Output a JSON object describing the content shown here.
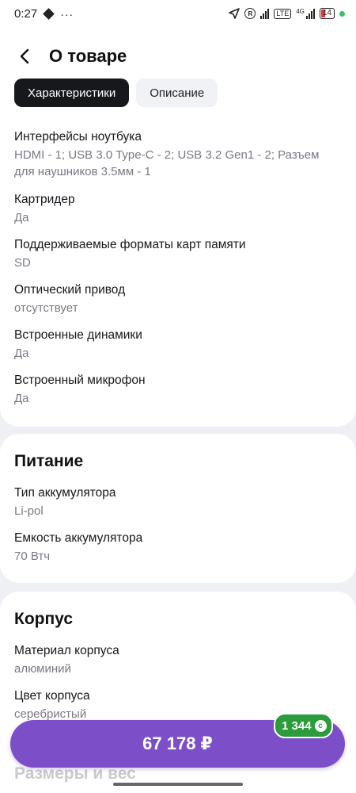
{
  "status_bar": {
    "time": "0:27",
    "battery": "14",
    "net_badge": "4G"
  },
  "header": {
    "title": "О товаре"
  },
  "tabs": [
    {
      "label": "Характеристики",
      "active": true
    },
    {
      "label": "Описание",
      "active": false
    }
  ],
  "specs_general": [
    {
      "label": "Интерфейсы ноутбука",
      "value": "HDMI - 1; USB 3.0 Type-C - 2; USB 3.2 Gen1 - 2; Разъем для наушников 3.5мм - 1"
    },
    {
      "label": "Картридер",
      "value": "Да"
    },
    {
      "label": "Поддерживаемые форматы карт памяти",
      "value": "SD"
    },
    {
      "label": "Оптический привод",
      "value": "отсутствует"
    },
    {
      "label": "Встроенные динамики",
      "value": "Да"
    },
    {
      "label": "Встроенный микрофон",
      "value": "Да"
    }
  ],
  "power": {
    "title": "Питание",
    "items": [
      {
        "label": "Тип аккумулятора",
        "value": "Li-pol"
      },
      {
        "label": "Емкость аккумулятора",
        "value": "70 Втч"
      }
    ]
  },
  "body_section": {
    "title": "Корпус",
    "items": [
      {
        "label": "Материал корпуса",
        "value": "алюминий"
      },
      {
        "label": "Цвет корпуса",
        "value": "серебристый"
      }
    ]
  },
  "next_section_title": "Размеры и вес",
  "buy": {
    "price": "67 178 ₽",
    "bonus": "1 344"
  },
  "colors": {
    "accent": "#7c4fc9",
    "bonus": "#2b9b3c"
  }
}
